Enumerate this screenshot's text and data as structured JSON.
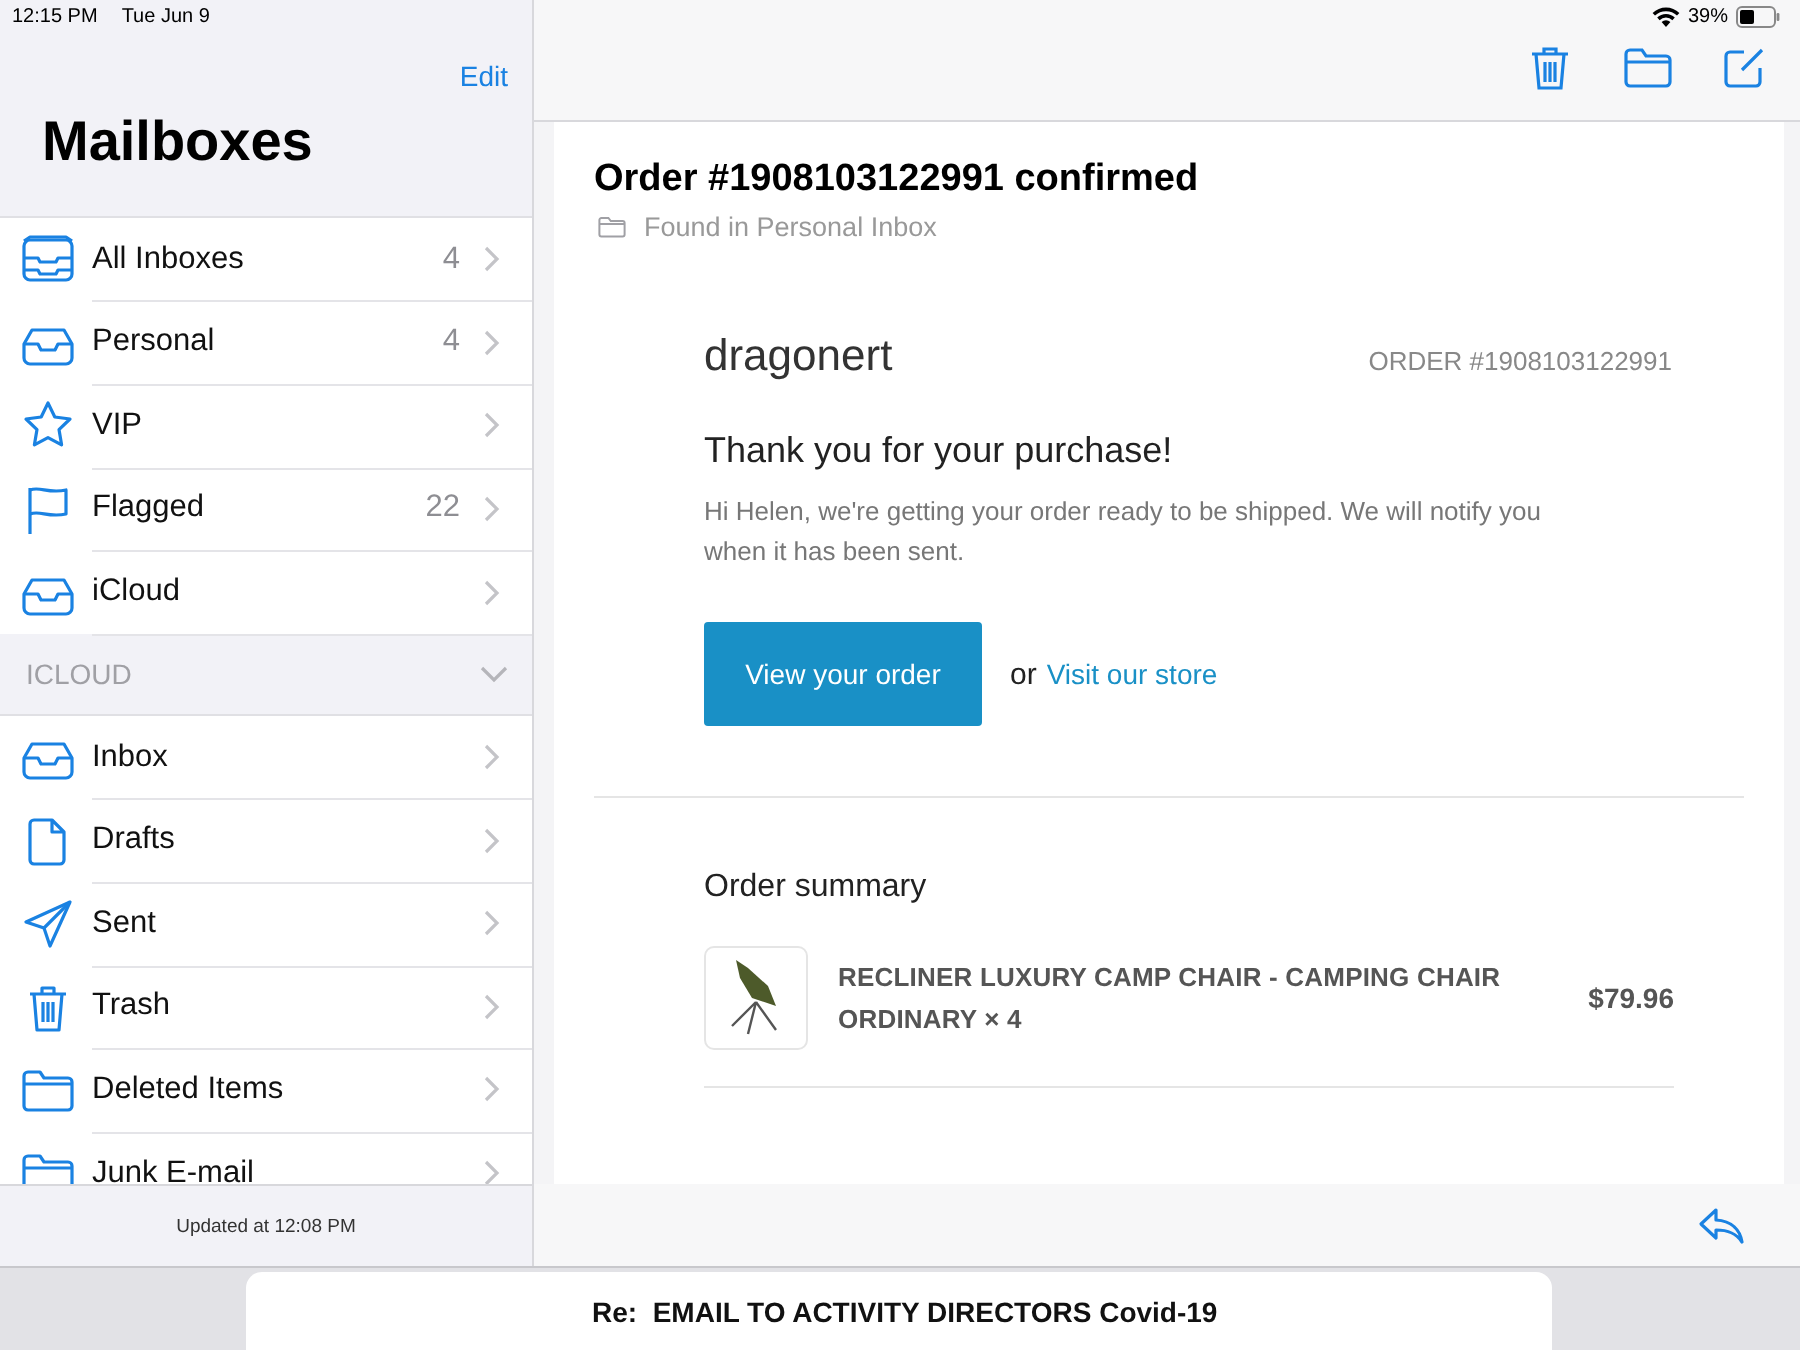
{
  "status_bar": {
    "time": "12:15 PM",
    "date": "Tue Jun 9",
    "battery": "39%"
  },
  "sidebar": {
    "edit": "Edit",
    "title": "Mailboxes",
    "items": [
      {
        "kind": "all-inboxes",
        "label": "All Inboxes",
        "count": "4"
      },
      {
        "kind": "inbox",
        "label": "Personal",
        "count": "4"
      },
      {
        "kind": "star",
        "label": "VIP"
      },
      {
        "kind": "flag",
        "label": "Flagged",
        "count": "22"
      },
      {
        "kind": "inbox",
        "label": "iCloud"
      }
    ],
    "section": {
      "label": "ICLOUD",
      "expanded": true
    },
    "section_items": [
      {
        "kind": "inbox",
        "label": "Inbox"
      },
      {
        "kind": "document",
        "label": "Drafts"
      },
      {
        "kind": "sent",
        "label": "Sent"
      },
      {
        "kind": "trash",
        "label": "Trash"
      },
      {
        "kind": "folder",
        "label": "Deleted Items"
      },
      {
        "kind": "folder",
        "label": "Junk E-mail"
      }
    ],
    "footer": "Updated at 12:08 PM"
  },
  "message": {
    "subject": "Order #1908103122991 confirmed",
    "location": "Found in Personal Inbox",
    "shop": "dragonert",
    "order_number": "ORDER #1908103122991",
    "heading": "Thank you for your purchase!",
    "body": "Hi Helen, we're getting your order ready to be shipped. We will notify you when it has been sent.",
    "button": "View your order",
    "or": "or",
    "link": "Visit our store",
    "summary_title": "Order summary",
    "items": [
      {
        "name": "RECLINER LUXURY CAMP CHAIR - CAMPING CHAIR ORDINARY × 4",
        "price": "$79.96"
      }
    ]
  },
  "draft_bar": {
    "subject": "Re:  EMAIL TO ACTIVITY DIRECTORS Covid-19"
  }
}
